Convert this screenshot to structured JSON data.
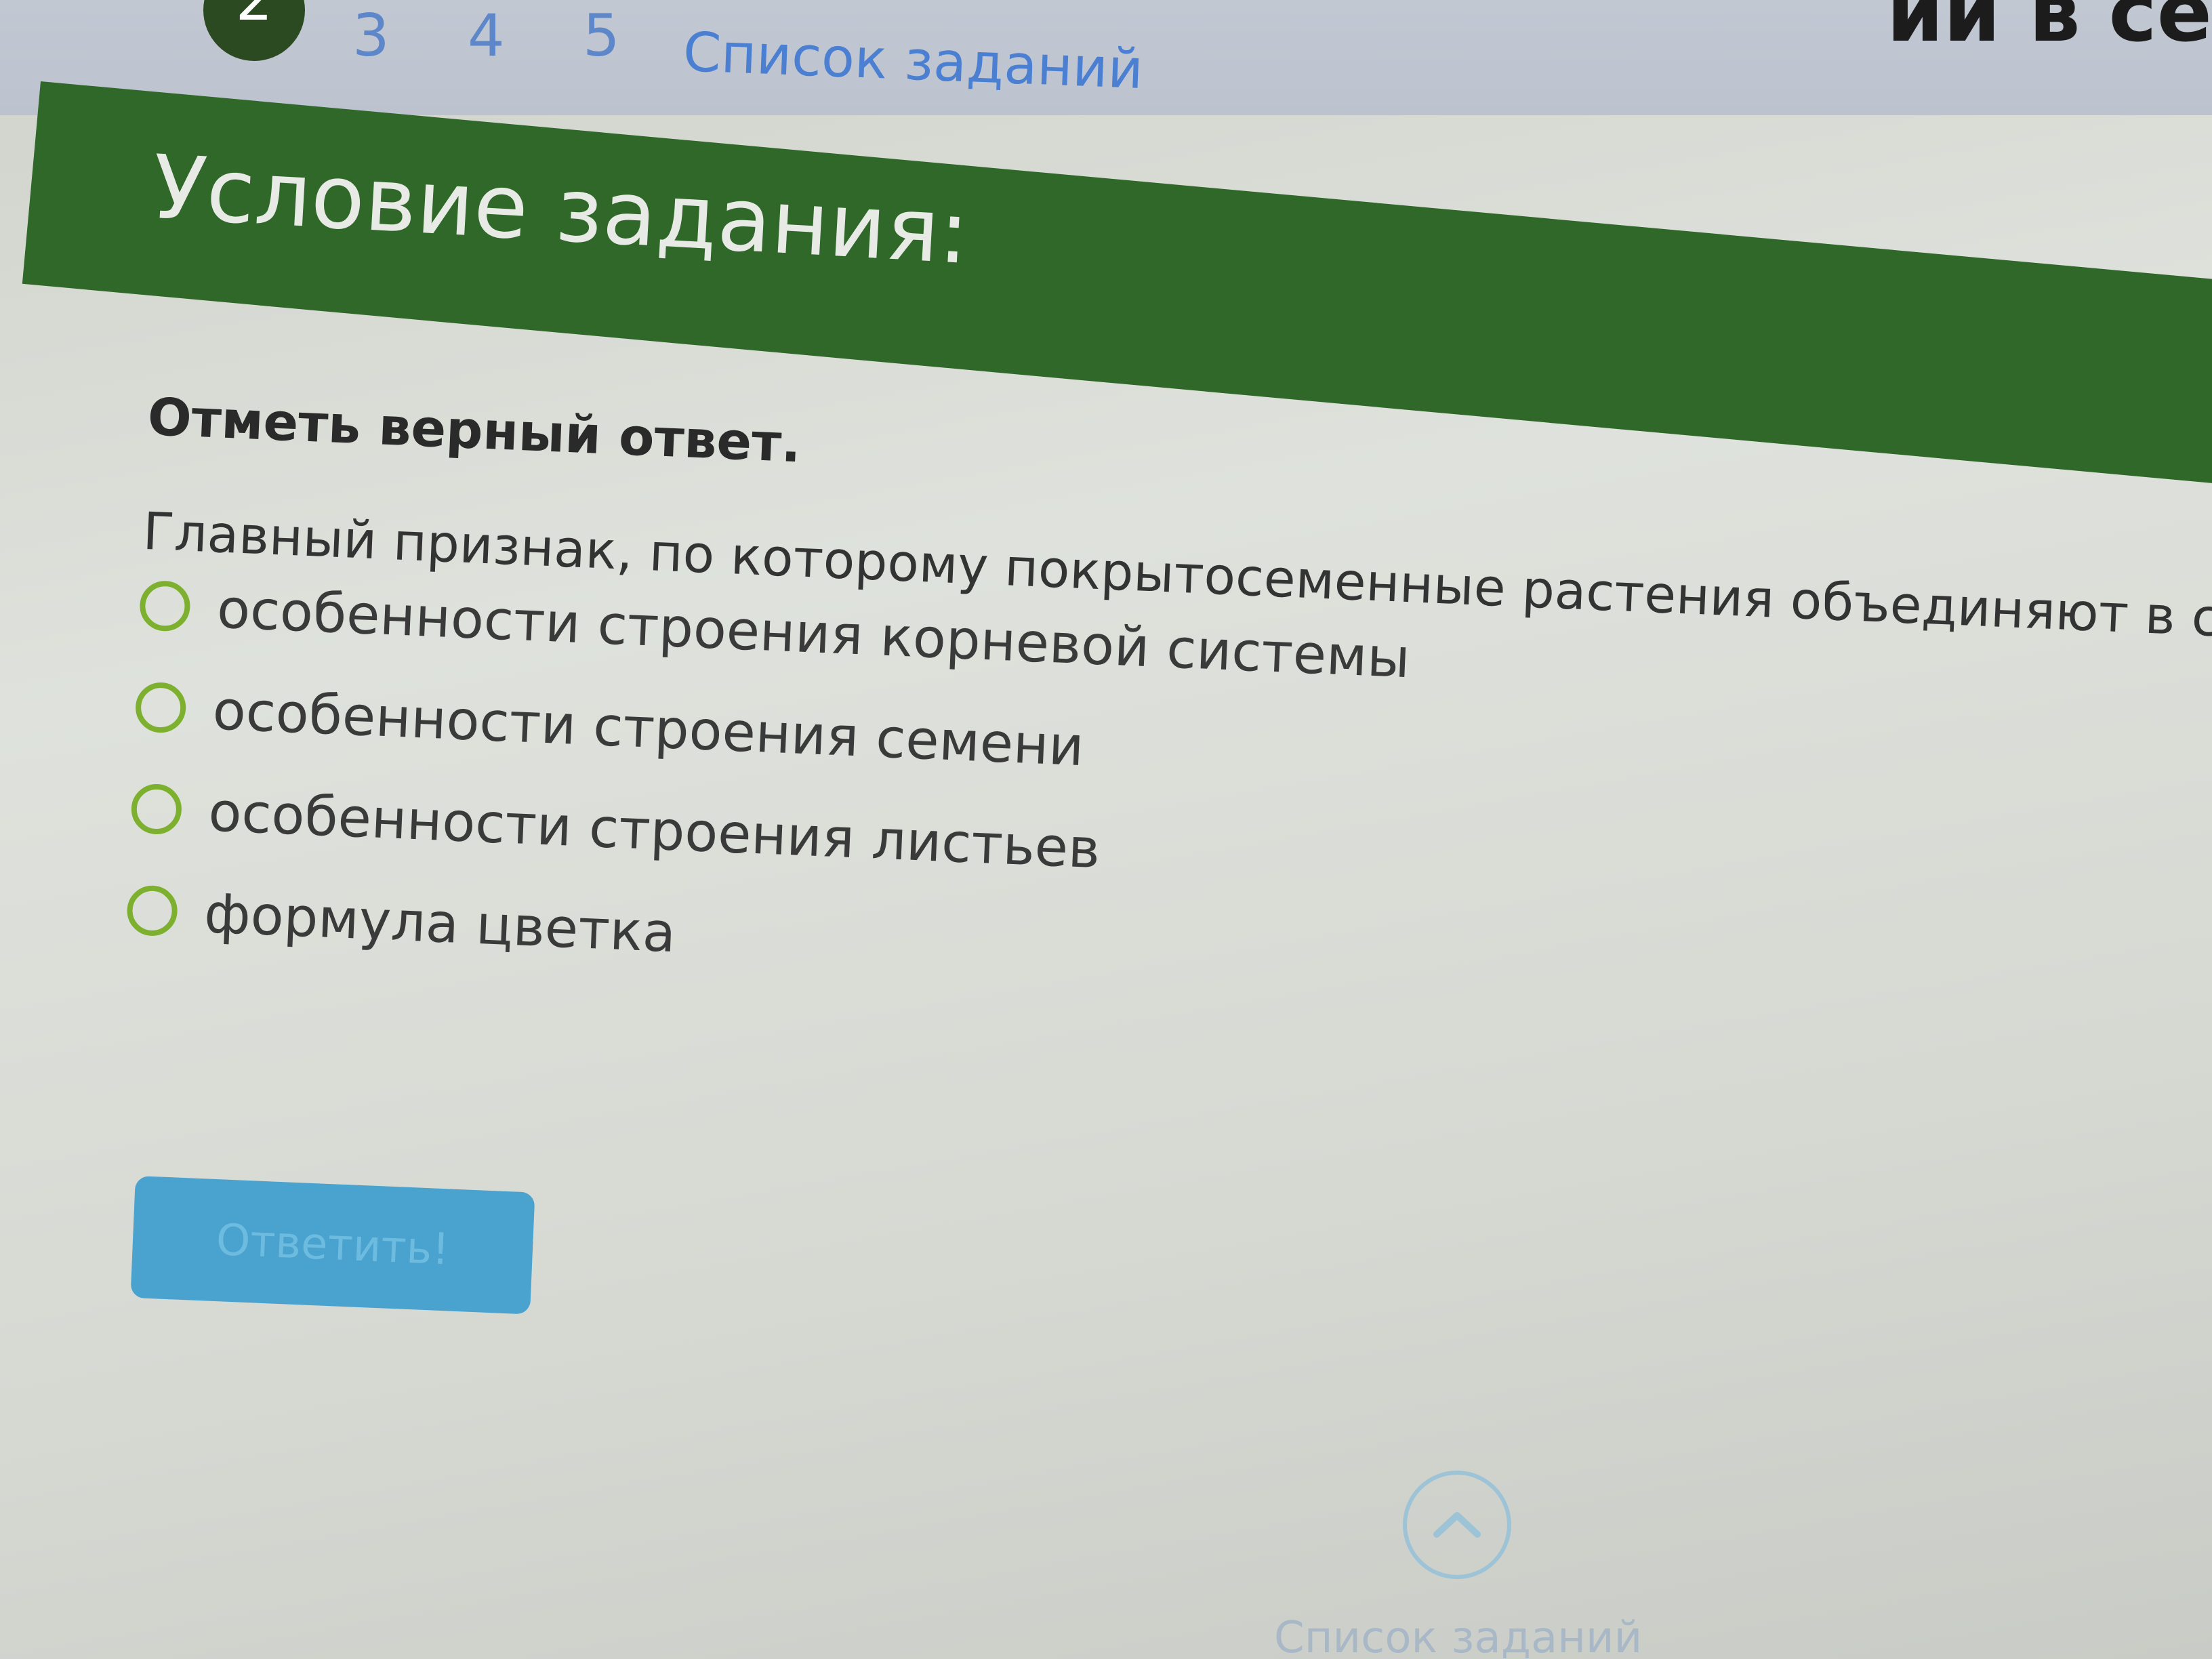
{
  "pager": {
    "items": [
      "2",
      "3",
      "4",
      "5"
    ],
    "list_link": "Список заданий"
  },
  "top_right_text": "ии в се",
  "header": {
    "title": "Условие задания:"
  },
  "task": {
    "instruction": "Отметь верный ответ.",
    "question": "Главный признак, по которому покрытосеменные растения объединяют в семейства:",
    "options": [
      "особенности строения корневой системы",
      "особенности строения семени",
      "особенности строения листьев",
      "формула цветка"
    ]
  },
  "submit_label": "Ответить!",
  "footer": {
    "list_link": "Список заданий"
  },
  "colors": {
    "header_green": "#30682a",
    "radio_green": "#7db02f",
    "button_blue": "#4aa2cf",
    "link_blue": "#4a7fd1"
  }
}
